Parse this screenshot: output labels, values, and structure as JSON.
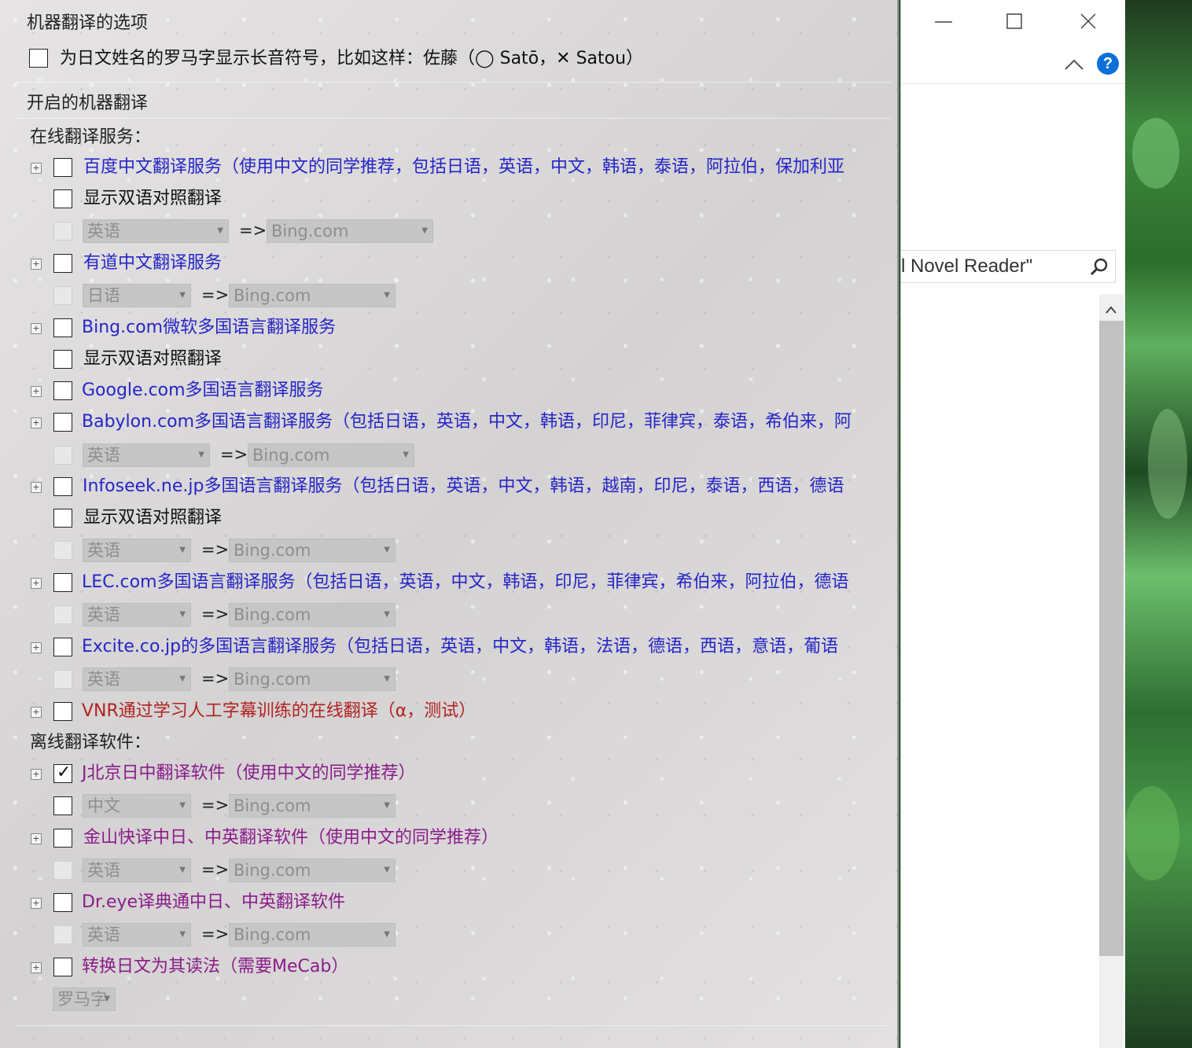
{
  "section_mt_options": {
    "title": "机器翻译的选项",
    "romaji_option": "为日文姓名的罗马字显示长音符号，比如这样：佐藤（◯ Satō，✕ Satou）"
  },
  "section_enabled": {
    "title": "开启的机器翻译",
    "online_label": "在线翻译服务：",
    "offline_label": "离线翻译软件："
  },
  "common": {
    "bilingual": "显示双语对照翻译",
    "arrow": "=>",
    "target": "Bing.com"
  },
  "services": {
    "baidu": {
      "label": "百度中文翻译服务（使用中文的同学推荐，包括日语，英语，中文，韩语，泰语，阿拉伯，保加利亚",
      "src": "英语"
    },
    "youdao": {
      "label": "有道中文翻译服务",
      "src": "日语"
    },
    "bing": {
      "label": "Bing.com微软多国语言翻译服务"
    },
    "google": {
      "label": "Google.com多国语言翻译服务"
    },
    "babylon": {
      "label": "Babylon.com多国语言翻译服务（包括日语，英语，中文，韩语，印尼，菲律宾，泰语，希伯来，阿",
      "src": "英语"
    },
    "infoseek": {
      "label": "Infoseek.ne.jp多国语言翻译服务（包括日语，英语，中文，韩语，越南，印尼，泰语，西语，德语",
      "src": "英语"
    },
    "lec": {
      "label": "LEC.com多国语言翻译服务（包括日语，英语，中文，韩语，印尼，菲律宾，希伯来，阿拉伯，德语",
      "src": "英语"
    },
    "excite": {
      "label": "Excite.co.jp的多国语言翻译服务（包括日语，英语，中文，韩语，法语，德语，西语，意语，葡语",
      "src": "英语"
    },
    "vnr": {
      "label": "VNR通过学习人工字幕训练的在线翻译（α，测试）"
    },
    "jbeijing": {
      "label": "J北京日中翻译软件（使用中文的同学推荐）",
      "src": "中文"
    },
    "kingsoft": {
      "label": "金山快译中日、中英翻译软件（使用中文的同学推荐）",
      "src": "英语"
    },
    "dreye": {
      "label": "Dr.eye译典通中日、中英翻译软件",
      "src": "英语"
    },
    "mecab": {
      "label": "转换日文为其读法（需要MeCab）",
      "src": "罗马字"
    }
  },
  "right_window": {
    "search_text": "l Novel Reader\"",
    "help": "?",
    "colors": {
      "help": "#0a6fd8"
    }
  },
  "icons": {
    "minimize": "minimize-icon",
    "maximize": "maximize-icon",
    "close": "close-icon",
    "collapse": "chevron-up-icon",
    "search": "search-icon",
    "expand": "plus-icon",
    "checkmark": "checkmark-icon"
  }
}
